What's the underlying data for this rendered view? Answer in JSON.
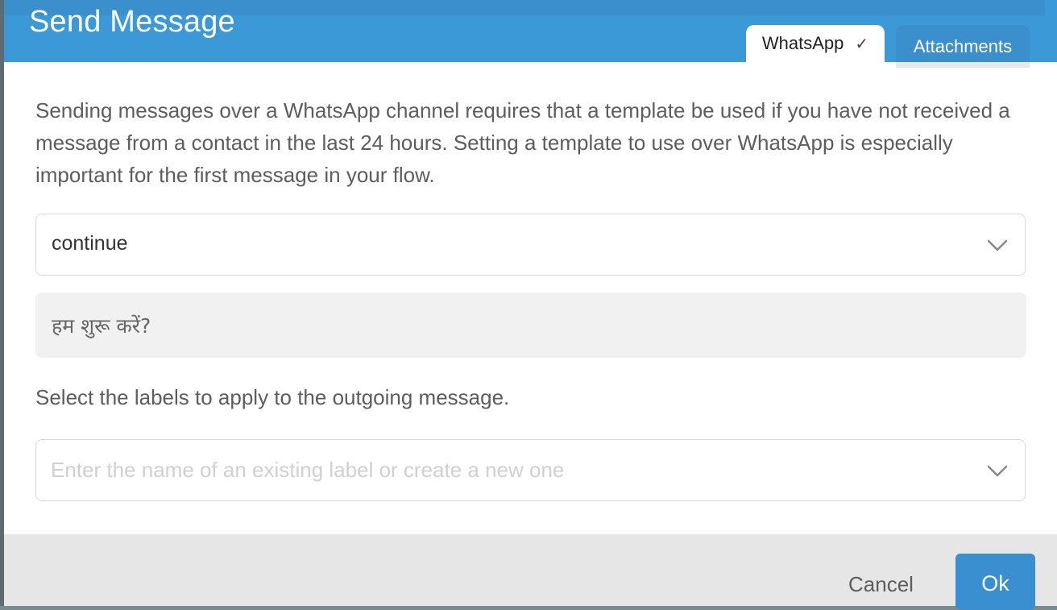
{
  "dialog": {
    "title": "Send Message",
    "tabs": [
      {
        "label": "WhatsApp",
        "active": true,
        "icon": "check-icon"
      },
      {
        "label": "Attachments",
        "active": false
      }
    ]
  },
  "body": {
    "description": "Sending messages over a WhatsApp channel requires that a template be used if you have not received a message from a contact in the last 24 hours. Setting a template to use over WhatsApp is especially important for the first message in your flow.",
    "template_select": {
      "value": "continue",
      "icon": "chevron-down-icon"
    },
    "template_preview": "हम शुरू करें?",
    "labels_prompt": "Select the labels to apply to the outgoing message.",
    "labels_select": {
      "placeholder": "Enter the name of an existing label or create a new one",
      "icon": "chevron-down-icon"
    }
  },
  "footer": {
    "cancel_label": "Cancel",
    "ok_label": "Ok"
  },
  "colors": {
    "header": "#3b99d8",
    "primary_button": "#3a8fd0",
    "footer": "#e6e6e6"
  }
}
